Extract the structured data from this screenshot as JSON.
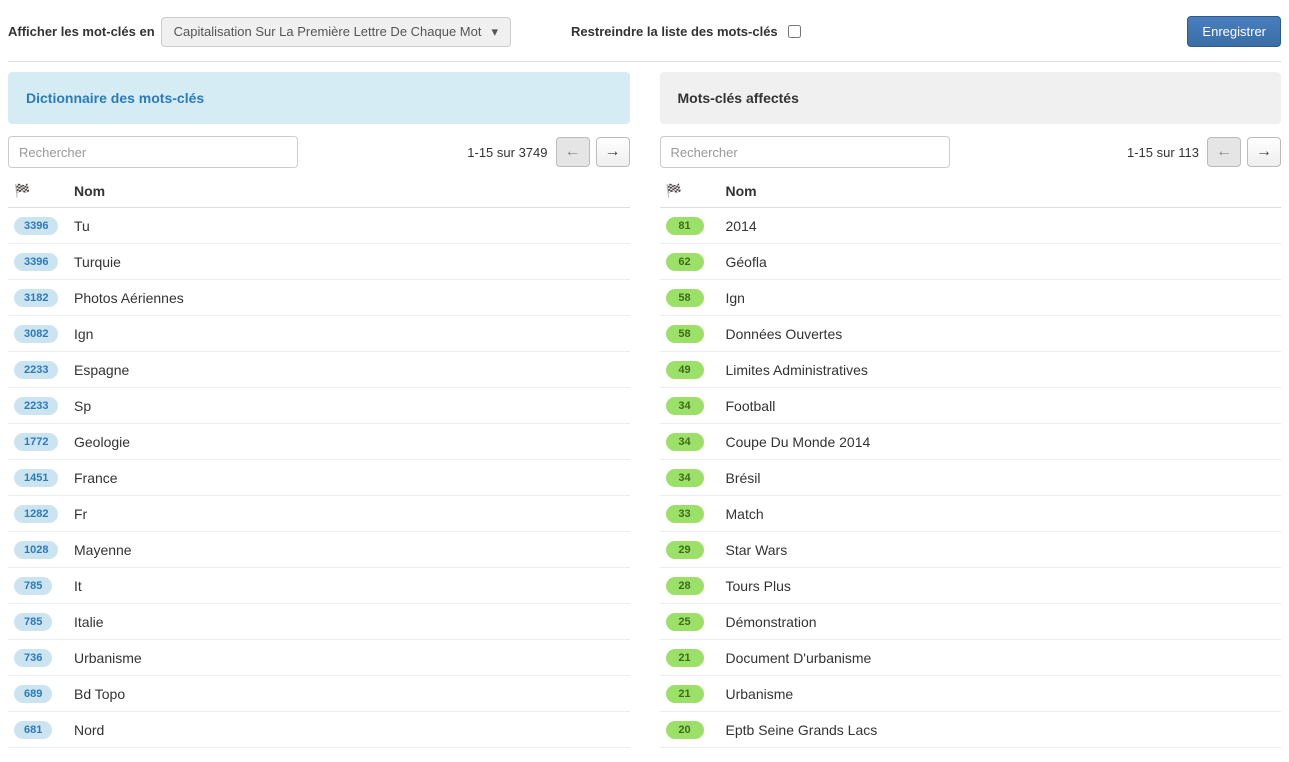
{
  "topbar": {
    "display_label": "Afficher les mot-clés en",
    "dropdown_value": "Capitalisation Sur La Première Lettre De Chaque Mot",
    "restrict_label": "Restreindre la liste des mots-clés",
    "save_label": "Enregistrer"
  },
  "left_panel": {
    "title": "Dictionnaire des mots-clés",
    "search_placeholder": "Rechercher",
    "pager_text": "1-15 sur 3749",
    "col_name": "Nom",
    "rows": [
      {
        "count": "3396",
        "name": "Tu"
      },
      {
        "count": "3396",
        "name": "Turquie"
      },
      {
        "count": "3182",
        "name": "Photos Aériennes"
      },
      {
        "count": "3082",
        "name": "Ign"
      },
      {
        "count": "2233",
        "name": "Espagne"
      },
      {
        "count": "2233",
        "name": "Sp"
      },
      {
        "count": "1772",
        "name": "Geologie"
      },
      {
        "count": "1451",
        "name": "France"
      },
      {
        "count": "1282",
        "name": "Fr"
      },
      {
        "count": "1028",
        "name": "Mayenne"
      },
      {
        "count": "785",
        "name": "It"
      },
      {
        "count": "785",
        "name": "Italie"
      },
      {
        "count": "736",
        "name": "Urbanisme"
      },
      {
        "count": "689",
        "name": "Bd Topo"
      },
      {
        "count": "681",
        "name": "Nord"
      }
    ]
  },
  "right_panel": {
    "title": "Mots-clés affectés",
    "search_placeholder": "Rechercher",
    "pager_text": "1-15 sur 113",
    "col_name": "Nom",
    "rows": [
      {
        "count": "81",
        "name": "2014"
      },
      {
        "count": "62",
        "name": "Géofla"
      },
      {
        "count": "58",
        "name": "Ign"
      },
      {
        "count": "58",
        "name": "Données Ouvertes"
      },
      {
        "count": "49",
        "name": "Limites Administratives"
      },
      {
        "count": "34",
        "name": "Football"
      },
      {
        "count": "34",
        "name": "Coupe Du Monde 2014"
      },
      {
        "count": "34",
        "name": "Brésil"
      },
      {
        "count": "33",
        "name": "Match"
      },
      {
        "count": "29",
        "name": "Star Wars"
      },
      {
        "count": "28",
        "name": "Tours Plus"
      },
      {
        "count": "25",
        "name": "Démonstration"
      },
      {
        "count": "21",
        "name": "Document D'urbanisme"
      },
      {
        "count": "21",
        "name": "Urbanisme"
      },
      {
        "count": "20",
        "name": "Eptb Seine Grands Lacs"
      }
    ]
  }
}
